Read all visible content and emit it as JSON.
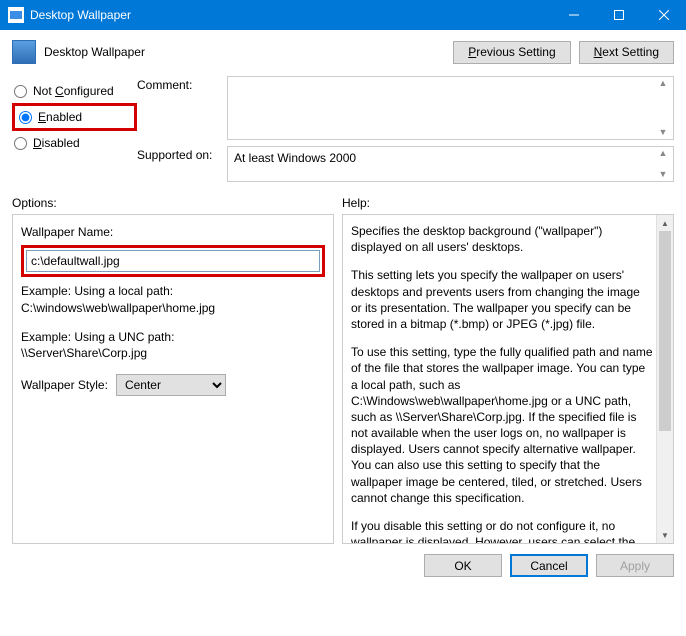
{
  "window": {
    "title": "Desktop Wallpaper"
  },
  "header": {
    "policy_name": "Desktop Wallpaper",
    "prev": "Previous Setting",
    "next": "Next Setting"
  },
  "state": {
    "not_configured": "Not Configured",
    "enabled": "Enabled",
    "disabled": "Disabled",
    "selected": "enabled"
  },
  "fields": {
    "comment_label": "Comment:",
    "comment_value": "",
    "supported_label": "Supported on:",
    "supported_value": "At least Windows 2000"
  },
  "sections": {
    "options": "Options:",
    "help": "Help:"
  },
  "options": {
    "wallpaper_name_label": "Wallpaper Name:",
    "wallpaper_name_value": "c:\\defaultwall.jpg",
    "example_local_label": "Example: Using a local path:",
    "example_local_value": "C:\\windows\\web\\wallpaper\\home.jpg",
    "example_unc_label": "Example: Using a UNC path:",
    "example_unc_value": "\\\\Server\\Share\\Corp.jpg",
    "style_label": "Wallpaper Style:",
    "style_value": "Center"
  },
  "help": {
    "p1": "Specifies the desktop background (\"wallpaper\") displayed on all users' desktops.",
    "p2": "This setting lets you specify the wallpaper on users' desktops and prevents users from changing the image or its presentation. The wallpaper you specify can be stored in a bitmap (*.bmp) or JPEG (*.jpg) file.",
    "p3": "To use this setting, type the fully qualified path and name of the file that stores the wallpaper image. You can type a local path, such as C:\\Windows\\web\\wallpaper\\home.jpg or a UNC path, such as \\\\Server\\Share\\Corp.jpg. If the specified file is not available when the user logs on, no wallpaper is displayed. Users cannot specify alternative wallpaper. You can also use this setting to specify that the wallpaper image be centered, tiled, or stretched. Users cannot change this specification.",
    "p4": "If you disable this setting or do not configure it, no wallpaper is displayed. However, users can select the wallpaper of their choice."
  },
  "buttons": {
    "ok": "OK",
    "cancel": "Cancel",
    "apply": "Apply"
  }
}
